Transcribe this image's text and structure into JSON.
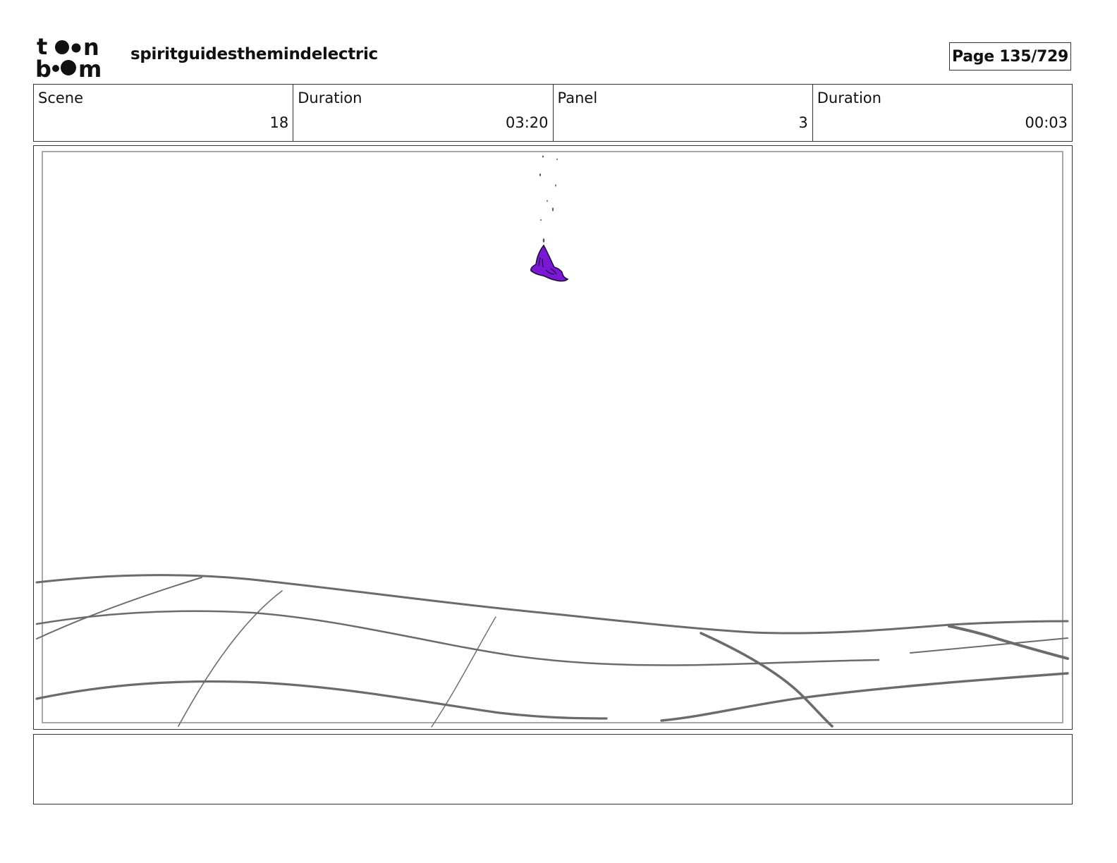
{
  "header": {
    "logo_text": "toon boom",
    "project_title": "spiritguidesthemindelectric",
    "page_indicator": "Page 135/729"
  },
  "info": [
    {
      "label": "Scene",
      "value": "18"
    },
    {
      "label": "Duration",
      "value": "03:20"
    },
    {
      "label": "Panel",
      "value": "3"
    },
    {
      "label": "Duration",
      "value": "00:03"
    }
  ],
  "panel": {
    "description": "",
    "colors": {
      "ground_lines": "#6b6b6b",
      "character_fill": "#7b17d6",
      "character_outline": "#1a0a2e",
      "safe_frame": "#a8a8a8"
    }
  },
  "notes": {
    "text": ""
  }
}
